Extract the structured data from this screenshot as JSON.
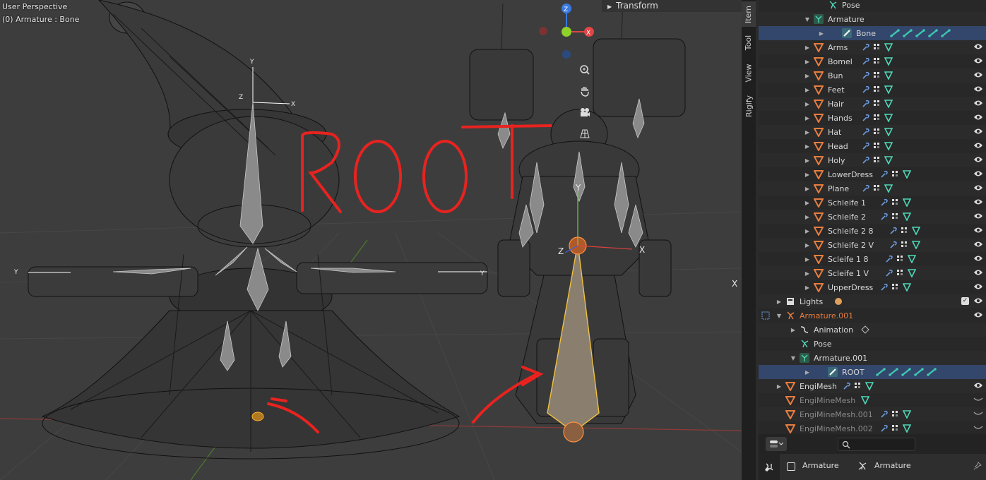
{
  "viewport": {
    "mode_label": "User Perspective",
    "context_label": "(0) Armature : Bone",
    "annotation_text": "ROOT",
    "gizmo": {
      "z": "Z",
      "y": "Y",
      "x": "X"
    }
  },
  "n_panel": {
    "transform_label": "Transform"
  },
  "side_tabs": [
    "Item",
    "Tool",
    "View",
    "Rigify"
  ],
  "outliner": {
    "rows": [
      {
        "label": "Pose",
        "indent": 3,
        "icon": "pose-icon",
        "expander": false,
        "mods": "",
        "eye": false
      },
      {
        "label": "Armature",
        "indent": 2,
        "icon": "armature-data-icon",
        "expander": "open",
        "mods": "",
        "eye": false
      },
      {
        "label": "Bone",
        "indent": 3,
        "icon": "bone-icon",
        "expander": "closed",
        "mods": "bones",
        "eye": false,
        "selected": true
      },
      {
        "label": "Arms",
        "indent": 2,
        "icon": "mesh-icon",
        "expander": "closed",
        "mods": "mesh",
        "eye": true
      },
      {
        "label": "Bomel",
        "indent": 2,
        "icon": "mesh-icon",
        "expander": "closed",
        "mods": "mesh",
        "eye": true
      },
      {
        "label": "Bun",
        "indent": 2,
        "icon": "mesh-icon",
        "expander": "closed",
        "mods": "mesh",
        "eye": true
      },
      {
        "label": "Feet",
        "indent": 2,
        "icon": "mesh-icon",
        "expander": "closed",
        "mods": "mesh",
        "eye": true
      },
      {
        "label": "Hair",
        "indent": 2,
        "icon": "mesh-icon",
        "expander": "closed",
        "mods": "mesh",
        "eye": true
      },
      {
        "label": "Hands",
        "indent": 2,
        "icon": "mesh-icon",
        "expander": "closed",
        "mods": "mesh",
        "eye": true
      },
      {
        "label": "Hat",
        "indent": 2,
        "icon": "mesh-icon",
        "expander": "closed",
        "mods": "mesh",
        "eye": true
      },
      {
        "label": "Head",
        "indent": 2,
        "icon": "mesh-icon",
        "expander": "closed",
        "mods": "mesh",
        "eye": true
      },
      {
        "label": "Holy",
        "indent": 2,
        "icon": "mesh-icon",
        "expander": "closed",
        "mods": "mesh",
        "eye": true
      },
      {
        "label": "LowerDress",
        "indent": 2,
        "icon": "mesh-icon",
        "expander": "closed",
        "mods": "mesh",
        "eye": true
      },
      {
        "label": "Plane",
        "indent": 2,
        "icon": "mesh-icon",
        "expander": "closed",
        "mods": "mesh",
        "eye": true
      },
      {
        "label": "Schleife 1",
        "indent": 2,
        "icon": "mesh-icon",
        "expander": "closed",
        "mods": "mesh",
        "eye": true
      },
      {
        "label": "Schleife 2",
        "indent": 2,
        "icon": "mesh-icon",
        "expander": "closed",
        "mods": "mesh",
        "eye": true
      },
      {
        "label": "Schleife 2 8",
        "indent": 2,
        "icon": "mesh-icon",
        "expander": "closed",
        "mods": "mesh",
        "eye": true
      },
      {
        "label": "Schleife 2 V",
        "indent": 2,
        "icon": "mesh-icon",
        "expander": "closed",
        "mods": "mesh",
        "eye": true
      },
      {
        "label": "Scleife 1 8",
        "indent": 2,
        "icon": "mesh-icon",
        "expander": "closed",
        "mods": "mesh",
        "eye": true
      },
      {
        "label": "Scleife 1 V",
        "indent": 2,
        "icon": "mesh-icon",
        "expander": "closed",
        "mods": "mesh",
        "eye": true
      },
      {
        "label": "UpperDress",
        "indent": 2,
        "icon": "mesh-icon",
        "expander": "closed",
        "mods": "mesh",
        "eye": true
      },
      {
        "label": "Lights",
        "indent": 0,
        "icon": "collection-icon",
        "expander": "closed",
        "mods": "light",
        "eye": true,
        "checkbox": true
      },
      {
        "label": "Armature.001",
        "indent": 0,
        "icon": "armature-object-icon",
        "expander": "open",
        "mods": "",
        "eye": true,
        "orange": true,
        "active_obj": true
      },
      {
        "label": "Animation",
        "indent": 1,
        "icon": "animation-icon",
        "expander": "closed",
        "mods": "anim",
        "eye": false
      },
      {
        "label": "Pose",
        "indent": 1,
        "icon": "pose-icon",
        "expander": false,
        "mods": "",
        "eye": false
      },
      {
        "label": "Armature.001",
        "indent": 1,
        "icon": "armature-data-icon",
        "expander": "open",
        "mods": "",
        "eye": false
      },
      {
        "label": "ROOT",
        "indent": 2,
        "icon": "bone-icon",
        "expander": "closed",
        "mods": "bones",
        "eye": false,
        "selected": true
      },
      {
        "label": "EngiMesh",
        "indent": 0,
        "icon": "mesh-icon",
        "expander": "closed",
        "mods": "mesh",
        "eye": true
      },
      {
        "label": "EngiMineMesh",
        "indent": 0,
        "icon": "mesh-icon",
        "expander": false,
        "mods": "tri",
        "eye": "closed",
        "dim": true
      },
      {
        "label": "EngiMineMesh.001",
        "indent": 0,
        "icon": "mesh-icon",
        "expander": false,
        "mods": "mesh2",
        "eye": "closed",
        "dim": true
      },
      {
        "label": "EngiMineMesh.002",
        "indent": 0,
        "icon": "mesh-icon",
        "expander": false,
        "mods": "mesh2",
        "eye": "closed",
        "dim": true
      }
    ]
  },
  "footer": {
    "search_placeholder": ""
  },
  "properties": {
    "object_name": "Armature",
    "data_name": "Armature"
  },
  "colors": {
    "viewport_bg": "#3d3d3d",
    "selected_row": "#33466b",
    "annotation_red": "#e8231f",
    "bone_select": "#f0c040",
    "mesh_orange": "#e87d3e",
    "bone_teal": "#3fc8b0"
  }
}
